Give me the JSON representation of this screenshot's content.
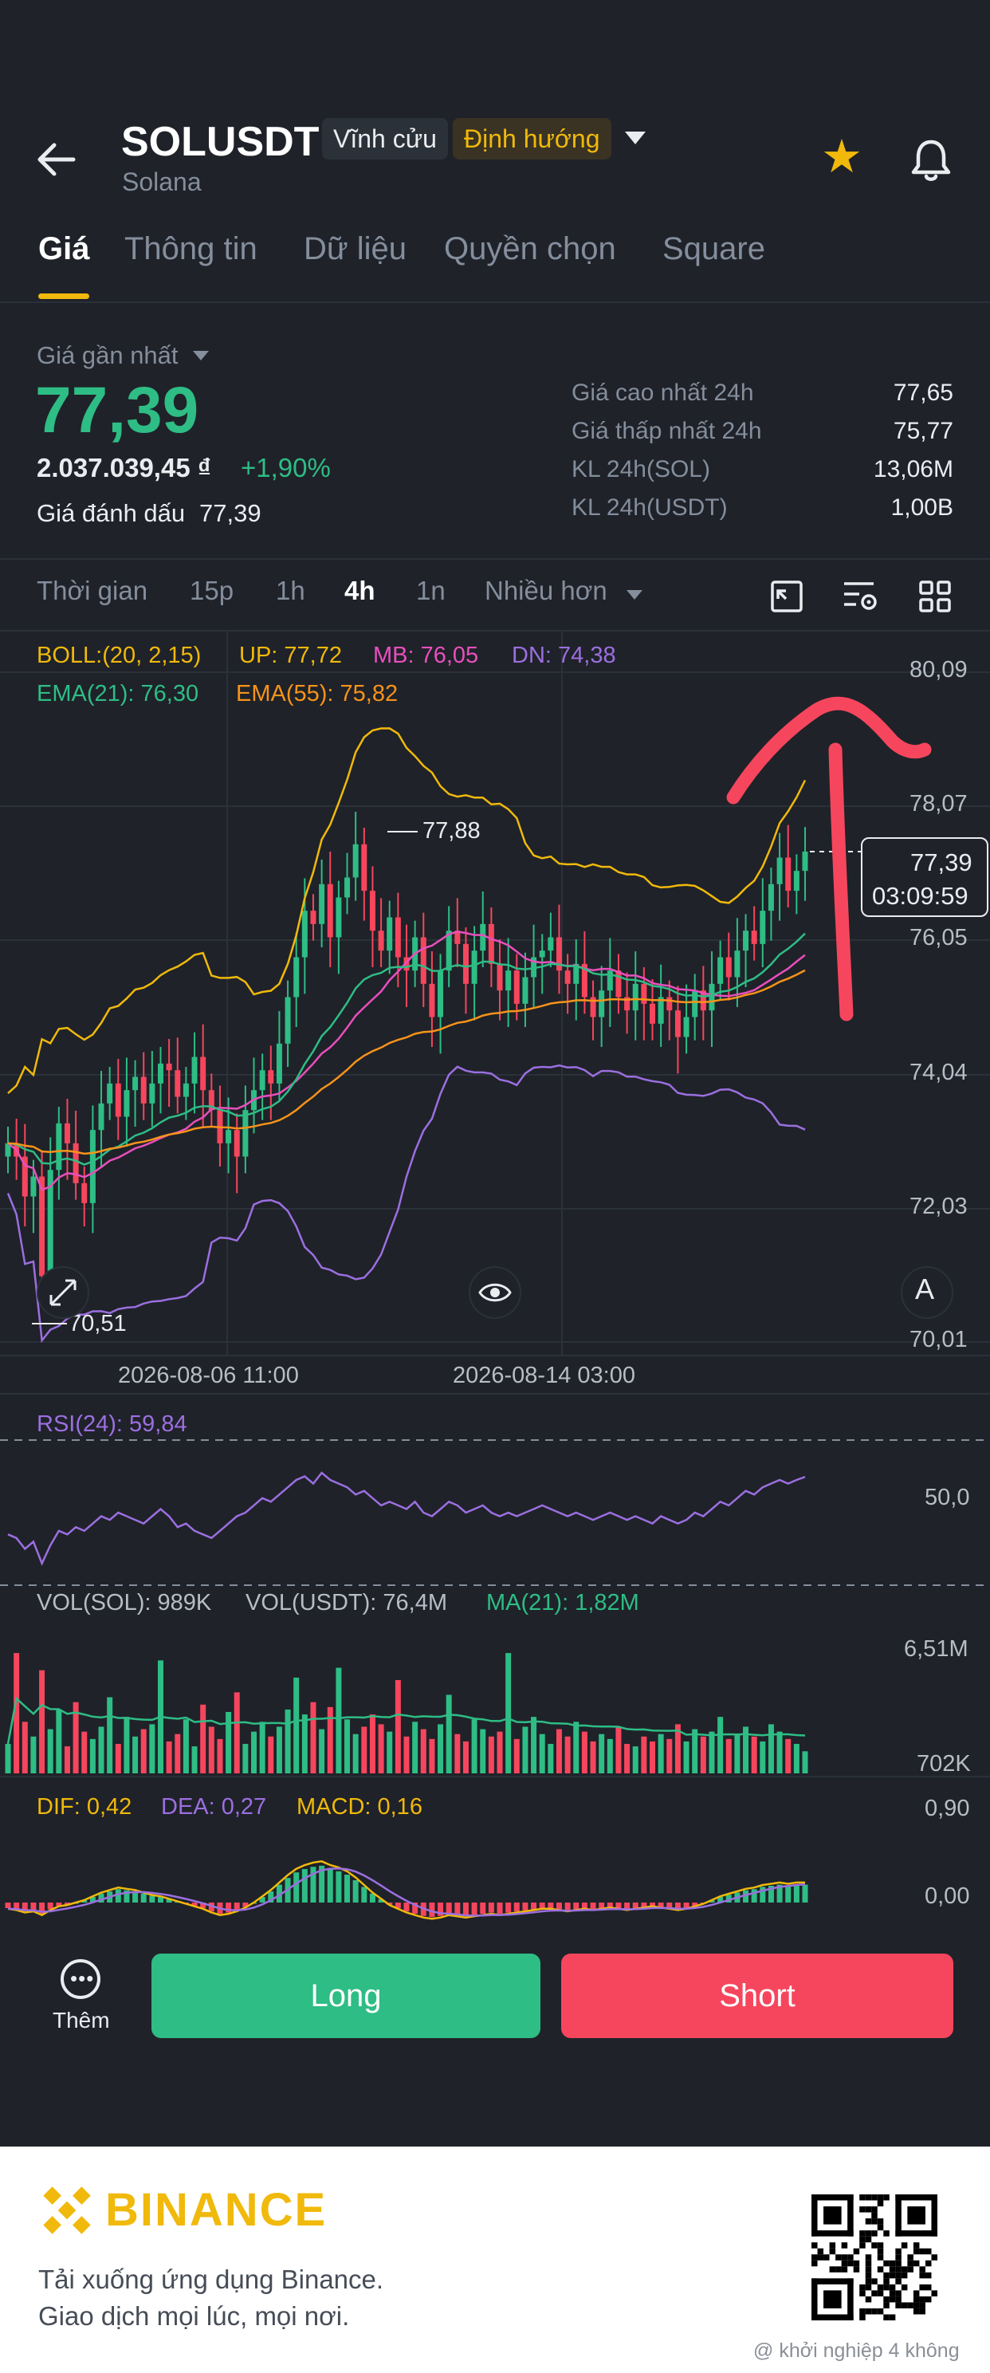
{
  "header": {
    "symbol": "SOLUSDT",
    "badge_perpetual": "Vĩnh cửu",
    "badge_direction": "Định hướng",
    "subtitle": "Solana",
    "icons": [
      "back-arrow-icon",
      "chevron-down-icon",
      "star-icon",
      "bell-icon"
    ]
  },
  "tabs": [
    "Giá",
    "Thông tin",
    "Dữ liệu",
    "Quyền chọn",
    "Square"
  ],
  "price_panel": {
    "last_price_label": "Giá gần nhất",
    "last_price": "77,39",
    "vnd_value": "2.037.039,45 ₫",
    "change_pct": "+1,90%",
    "mark_label": "Giá đánh dấu",
    "mark_value": "77,39",
    "stats": [
      {
        "label": "Giá cao nhất 24h",
        "value": "77,65"
      },
      {
        "label": "Giá thấp nhất 24h",
        "value": "75,77"
      },
      {
        "label": "KL 24h(SOL)",
        "value": "13,06M"
      },
      {
        "label": "KL 24h(USDT)",
        "value": "1,00B"
      }
    ]
  },
  "timebar": {
    "items": [
      "Thời gian",
      "15p",
      "1h",
      "4h",
      "1n",
      "Nhiều hơn"
    ],
    "active": "4h",
    "icons": [
      "chart-compare-icon",
      "indicator-settings-icon",
      "grid-layout-icon"
    ]
  },
  "legends": {
    "boll": "BOLL:(20, 2,15)",
    "up": "UP: 77,72",
    "mb": "MB: 76,05",
    "dn": "DN: 74,38",
    "ema21": "EMA(21): 76,30",
    "ema55": "EMA(55): 75,82",
    "rsi": "RSI(24): 59,84",
    "vol_sol": "VOL(SOL): 989K",
    "vol_usdt": "VOL(USDT): 76,4M",
    "ma21": "MA(21): 1,82M",
    "dif": "DIF: 0,42",
    "dea": "DEA: 0,27",
    "macd": "MACD: 0,16"
  },
  "price_tag": {
    "price": "77,39",
    "timer": "03:09:59"
  },
  "markers": {
    "high": "77,88",
    "low": "70,51"
  },
  "colors": {
    "up": "#2ebd85",
    "down": "#f6465d",
    "boll_up": "#f0b90b",
    "boll_mb": "#e84fbd",
    "boll_dn": "#9b6fe0",
    "ema21": "#2ebd85",
    "ema55": "#f7931a",
    "annotation": "#f6465d"
  },
  "actions": {
    "more": "Thêm",
    "long": "Long",
    "short": "Short"
  },
  "footer": {
    "brand": "BINANCE",
    "line1": "Tải xuống ứng dụng Binance.",
    "line2": "Giao dịch mọi lúc, mọi nơi.",
    "watermark": "@ khởi nghiệp 4 không"
  },
  "chart_data": [
    {
      "type": "candlestick",
      "title": "",
      "y_ticks": [
        "80,09",
        "78,07",
        "76,05",
        "74,04",
        "72,03",
        "70,01"
      ],
      "ylim": [
        70.01,
        80.09
      ],
      "x_ticks": [
        "2026-08-06 11:00",
        "2026-08-14 03:00"
      ],
      "closes": [
        73.0,
        72.8,
        72.2,
        72.5,
        71.0,
        72.6,
        73.3,
        73.0,
        72.4,
        72.1,
        73.2,
        73.6,
        73.9,
        73.4,
        73.8,
        74.0,
        73.6,
        73.9,
        74.2,
        74.1,
        73.7,
        73.9,
        74.3,
        73.8,
        73.5,
        73.0,
        73.2,
        72.8,
        73.5,
        73.8,
        74.1,
        73.9,
        74.5,
        75.2,
        75.8,
        76.5,
        76.3,
        76.9,
        76.1,
        76.7,
        77.0,
        77.5,
        76.8,
        76.2,
        75.9,
        76.4,
        75.8,
        75.6,
        76.1,
        75.4,
        74.9,
        75.6,
        76.2,
        76.0,
        75.4,
        75.9,
        76.3,
        75.7,
        75.3,
        75.6,
        75.1,
        75.5,
        75.8,
        75.9,
        76.1,
        75.6,
        75.4,
        75.7,
        75.2,
        74.9,
        75.3,
        75.6,
        75.2,
        75.0,
        75.4,
        75.1,
        74.8,
        75.2,
        75.0,
        74.6,
        74.9,
        75.3,
        75.0,
        75.4,
        75.8,
        75.5,
        75.9,
        76.2,
        76.0,
        76.5,
        76.9,
        77.3,
        76.8,
        77.1,
        77.39
      ],
      "highlights": {
        "high": 77.88,
        "low": 70.51
      },
      "annotation": "hand-drawn red upward arrow"
    },
    {
      "type": "line",
      "title": "RSI(24): 59,84",
      "y_ticks": [
        "50,0"
      ],
      "values": [
        44,
        43,
        40,
        42,
        36,
        41,
        45,
        44,
        46,
        45,
        47,
        49,
        48,
        50,
        49,
        48,
        47,
        49,
        51,
        49,
        46,
        47,
        45,
        44,
        43,
        45,
        47,
        49,
        50,
        52,
        54,
        53,
        55,
        57,
        59,
        60,
        58,
        61,
        59,
        58,
        57,
        55,
        56,
        54,
        52,
        53,
        52,
        51,
        53,
        50,
        49,
        51,
        53,
        52,
        50,
        51,
        52,
        50,
        49,
        50,
        49,
        50,
        51,
        52,
        51,
        50,
        49,
        50,
        49,
        48,
        49,
        50,
        49,
        48,
        49,
        48,
        47,
        49,
        48,
        47,
        48,
        50,
        49,
        51,
        53,
        52,
        54,
        56,
        55,
        57,
        58,
        59,
        58,
        59,
        59.84
      ]
    },
    {
      "type": "bar",
      "title": "VOL(SOL): 989K",
      "y_ticks": [
        "6,51M",
        "702K"
      ],
      "ma21_label": "MA(21): 1,82M",
      "values": [
        1.2,
        4.9,
        2.1,
        1.5,
        4.2,
        1.8,
        2.6,
        1.1,
        2.9,
        1.7,
        1.4,
        1.9,
        3.1,
        1.2,
        2.3,
        1.5,
        1.8,
        2.0,
        4.6,
        1.3,
        1.6,
        2.2,
        1.1,
        2.8,
        1.9,
        1.4,
        2.5,
        3.3,
        1.2,
        1.7,
        2.1,
        1.5,
        1.9,
        2.6,
        3.9,
        2.4,
        2.9,
        1.8,
        2.7,
        4.3,
        2.2,
        1.6,
        1.9,
        2.4,
        2.0,
        1.7,
        3.8,
        1.5,
        2.1,
        1.8,
        1.4,
        2.0,
        3.2,
        1.6,
        1.3,
        2.2,
        1.8,
        1.5,
        1.7,
        4.9,
        1.4,
        1.9,
        2.3,
        1.6,
        1.2,
        1.8,
        1.5,
        2.1,
        1.7,
        1.3,
        1.6,
        1.4,
        1.9,
        1.2,
        1.1,
        1.5,
        1.3,
        1.6,
        1.4,
        2.0,
        1.3,
        1.8,
        1.5,
        1.7,
        2.3,
        1.4,
        1.6,
        1.9,
        1.5,
        1.3,
        2.0,
        1.7,
        1.4,
        1.2,
        0.9
      ]
    },
    {
      "type": "bar",
      "title": "MACD",
      "y_ticks": [
        "0,90",
        "0,00"
      ],
      "values": [
        -0.05,
        -0.06,
        -0.08,
        -0.07,
        -0.1,
        -0.06,
        -0.03,
        -0.02,
        0.0,
        0.02,
        0.05,
        0.08,
        0.1,
        0.12,
        0.11,
        0.1,
        0.08,
        0.06,
        0.05,
        0.03,
        0.01,
        -0.01,
        -0.03,
        -0.05,
        -0.08,
        -0.1,
        -0.09,
        -0.07,
        -0.04,
        0.0,
        0.05,
        0.1,
        0.16,
        0.22,
        0.27,
        0.3,
        0.32,
        0.33,
        0.3,
        0.28,
        0.25,
        0.2,
        0.14,
        0.08,
        0.03,
        -0.02,
        -0.05,
        -0.08,
        -0.1,
        -0.12,
        -0.13,
        -0.12,
        -0.1,
        -0.11,
        -0.12,
        -0.11,
        -0.1,
        -0.09,
        -0.1,
        -0.09,
        -0.08,
        -0.07,
        -0.06,
        -0.05,
        -0.05,
        -0.06,
        -0.07,
        -0.06,
        -0.05,
        -0.06,
        -0.05,
        -0.04,
        -0.05,
        -0.06,
        -0.05,
        -0.04,
        -0.03,
        -0.04,
        -0.05,
        -0.06,
        -0.05,
        -0.03,
        -0.01,
        0.02,
        0.05,
        0.07,
        0.09,
        0.11,
        0.12,
        0.14,
        0.15,
        0.16,
        0.15,
        0.16,
        0.16
      ]
    }
  ]
}
